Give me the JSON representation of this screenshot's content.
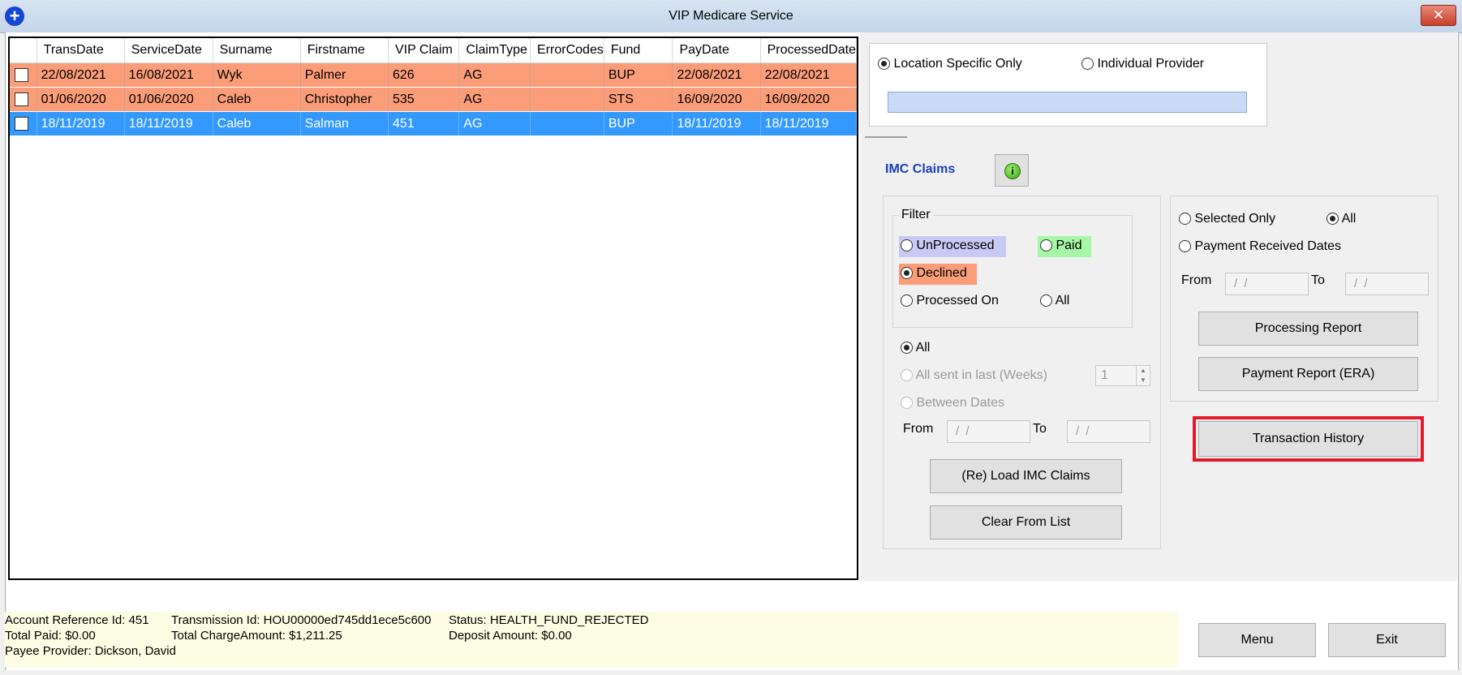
{
  "window": {
    "title": "VIP Medicare Service",
    "close_label": "✕",
    "app_icon": "+"
  },
  "grid": {
    "columns": [
      "TransDate",
      "ServiceDate",
      "Surname",
      "Firstname",
      "VIP Claim",
      "ClaimType",
      "ErrorCodes",
      "Fund",
      "PayDate",
      "ProcessedDate"
    ],
    "rows": [
      {
        "TransDate": "22/08/2021",
        "ServiceDate": "16/08/2021",
        "Surname": "Wyk",
        "Firstname": "Palmer",
        "VIPClaim": "626",
        "ClaimType": "AG",
        "ErrorCodes": "",
        "Fund": "BUP",
        "PayDate": "22/08/2021",
        "ProcessedDate": "22/08/2021"
      },
      {
        "TransDate": "01/06/2020",
        "ServiceDate": "01/06/2020",
        "Surname": "Caleb",
        "Firstname": "Christopher",
        "VIPClaim": "535",
        "ClaimType": "AG",
        "ErrorCodes": "",
        "Fund": "STS",
        "PayDate": "16/09/2020",
        "ProcessedDate": "16/09/2020"
      },
      {
        "TransDate": "18/11/2019",
        "ServiceDate": "18/11/2019",
        "Surname": "Caleb",
        "Firstname": "Salman",
        "VIPClaim": "451",
        "ClaimType": "AG",
        "ErrorCodes": "",
        "Fund": "BUP",
        "PayDate": "18/11/2019",
        "ProcessedDate": "18/11/2019"
      }
    ]
  },
  "provider": {
    "location_label": "Location Specific Only",
    "individual_label": "Individual Provider",
    "provider_value": ""
  },
  "imc": {
    "title": "IMC Claims",
    "info_icon": "i"
  },
  "filter": {
    "legend": "Filter",
    "unprocessed": "UnProcessed",
    "paid": "Paid",
    "declined": "Declined",
    "processed_on": "Processed On",
    "all": "All"
  },
  "range": {
    "all": "All",
    "sent_last": "All sent in last (Weeks)",
    "weeks_value": "1",
    "between": "Between Dates",
    "from": "From",
    "to": "To",
    "date_placeholder": "/ /"
  },
  "buttons": {
    "load": "(Re) Load IMC Claims",
    "clear": "Clear From List",
    "processing_report": "Processing Report",
    "payment_report": "Payment Report (ERA)",
    "transaction_history": "Transaction History",
    "menu": "Menu",
    "exit": "Exit"
  },
  "report": {
    "selected_only": "Selected Only",
    "all": "All",
    "payment_received": "Payment Received Dates",
    "from": "From",
    "to": "To"
  },
  "status": {
    "line1a": "Account Reference Id: 451",
    "line1b": "Transmission Id: HOU00000ed745dd1ece5c600",
    "line1c": "Status: HEALTH_FUND_REJECTED",
    "line2a": "Total Paid: $0.00",
    "line2b": "Total ChargeAmount: $1,211.25",
    "line2c": "Deposit Amount: $0.00",
    "line3a": "Payee Provider: Dickson, David"
  },
  "colors": {
    "declined": "#fc9d79",
    "selected": "#3399ff",
    "paid": "#a6f7a6",
    "unprocessed": "#c9c9f5",
    "highlight": "#e21b2c"
  }
}
